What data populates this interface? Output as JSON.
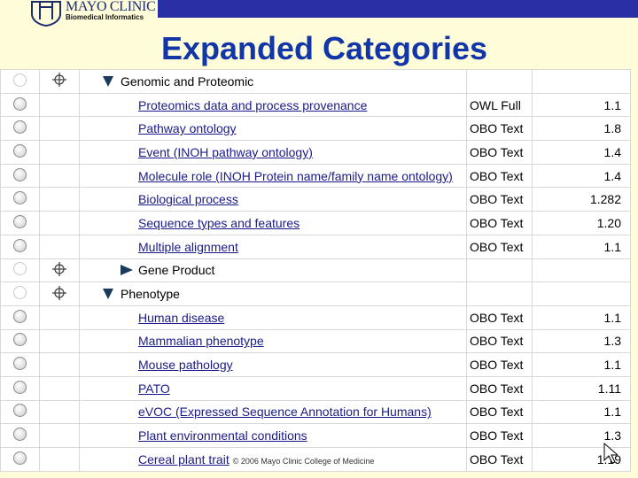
{
  "header": {
    "logo_name": "MAYO CLINIC",
    "logo_sub": "Biomedical Informatics",
    "title": "Expanded Categories",
    "bar_color": "#2a2fa6"
  },
  "footer": {
    "copyright": "© 2006 Mayo Clinic College of Medicine"
  },
  "rows": [
    {
      "type": "category",
      "label": "Genomic and Proteomic",
      "state": "expanded",
      "level": 0
    },
    {
      "type": "item",
      "label": "Proteomics data and process provenance",
      "format": "OWL Full",
      "version": "1.1"
    },
    {
      "type": "item",
      "label": "Pathway ontology",
      "format": "OBO Text",
      "version": "1.8"
    },
    {
      "type": "item",
      "label": "Event (INOH pathway ontology)",
      "format": "OBO Text",
      "version": "1.4"
    },
    {
      "type": "item",
      "label": "Molecule role (INOH Protein name/family name ontology)",
      "format": "OBO Text",
      "version": "1.4"
    },
    {
      "type": "item",
      "label": "Biological process",
      "format": "OBO Text",
      "version": "1.282"
    },
    {
      "type": "item",
      "label": "Sequence types and features",
      "format": "OBO Text",
      "version": "1.20"
    },
    {
      "type": "item",
      "label": "Multiple alignment",
      "format": "OBO Text",
      "version": "1.1"
    },
    {
      "type": "category",
      "label": "Gene Product",
      "state": "collapsed",
      "level": 1
    },
    {
      "type": "category",
      "label": "Phenotype",
      "state": "expanded",
      "level": 0
    },
    {
      "type": "item",
      "label": "Human disease",
      "format": "OBO Text",
      "version": "1.1"
    },
    {
      "type": "item",
      "label": "Mammalian phenotype",
      "format": "OBO Text",
      "version": "1.3"
    },
    {
      "type": "item",
      "label": "Mouse pathology",
      "format": "OBO Text",
      "version": "1.1"
    },
    {
      "type": "item",
      "label": "PATO",
      "format": "OBO Text",
      "version": "1.11"
    },
    {
      "type": "item",
      "label": "eVOC (Expressed Sequence Annotation for Humans)",
      "format": "OBO Text",
      "version": "1.1"
    },
    {
      "type": "item",
      "label": "Plant environmental conditions",
      "format": "OBO Text",
      "version": "1.3"
    },
    {
      "type": "item",
      "label": "Cereal plant trait",
      "format": "OBO Text",
      "version": "1.19"
    }
  ]
}
